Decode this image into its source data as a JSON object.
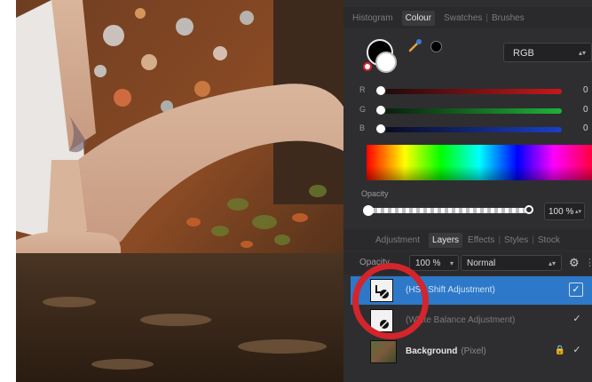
{
  "colour_panel": {
    "tabs": [
      "Histogram",
      "Colour",
      "Swatches",
      "Brushes"
    ],
    "active_tab": "Colour",
    "mode_value": "RGB",
    "channels": [
      {
        "label": "R",
        "value": "0",
        "color": "#c8181c"
      },
      {
        "label": "G",
        "value": "0",
        "color": "#1fb33a"
      },
      {
        "label": "B",
        "value": "0",
        "color": "#1a3fc9"
      }
    ],
    "opacity_label": "Opacity",
    "opacity_value": "100 %"
  },
  "layers_panel": {
    "tabs": [
      "Adjustment",
      "Layers",
      "Effects",
      "Styles",
      "Stock"
    ],
    "active_tab": "Layers",
    "opacity_label": "Opacity",
    "opacity_value": "100 %",
    "blend_mode": "Normal",
    "layers": [
      {
        "name": "(HSL Shift Adjustment)",
        "kind": "",
        "visible": true,
        "selected": true,
        "icon": "adjustment-thumb"
      },
      {
        "name": "(White Balance Adjustment)",
        "kind": "",
        "visible": true,
        "selected": false,
        "icon": "adjustment-thumb"
      },
      {
        "name": "Background",
        "kind": "(Pixel)",
        "visible": true,
        "selected": false,
        "locked": true,
        "icon": "image-thumb"
      }
    ]
  },
  "glyphs": {
    "check": "✓",
    "gear": "⚙",
    "more": "⋮",
    "arrows": "▴▾",
    "dropdown": "▾",
    "lock": "🔒"
  },
  "accent_color": "#2d78c8",
  "annotation_ring_color": "#d3252b"
}
